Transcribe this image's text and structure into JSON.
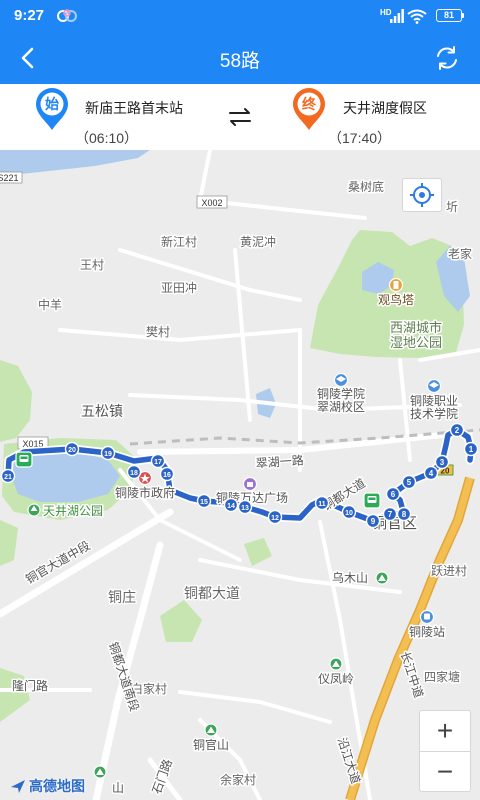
{
  "status_bar": {
    "time": "9:27",
    "network": "HD",
    "battery": "81"
  },
  "header": {
    "title": "58路"
  },
  "route": {
    "start": {
      "badge": "始",
      "name": "新庙王路首末站",
      "time": "（06:10）"
    },
    "end": {
      "badge": "终",
      "name": "天井湖度假区",
      "time": "（17:40）"
    }
  },
  "map": {
    "shields": {
      "s221": "S221",
      "x002": "X002",
      "x015": "X015",
      "g20": "20"
    },
    "places": {
      "sangshudi": "桑树底",
      "xinqi": "圻",
      "laojia": "老家",
      "xinjiangcun": "新江村",
      "huangnichong": "黄泥冲",
      "wangcun": "王村",
      "yatianchong": "亚田冲",
      "zhongyang": "中羊",
      "fancun": "樊村",
      "wusongzhen": "五松镇",
      "tongguanqu": "铜官区",
      "yuejincun": "跃进村",
      "tongzhuang": "铜庄",
      "baijiacun": "白家村",
      "sijiatang": "四家塘",
      "yujiacun": "余家村"
    },
    "pois": {
      "guanniaota": "观鸟塔",
      "xihu_park_1": "西湖城市",
      "xihu_park_2": "湿地公园",
      "tlu_1": "铜陵学院",
      "tlu_2": "翠湖校区",
      "tlvc_1": "铜陵职业",
      "tlvc_2": "技术学院",
      "city_gov": "铜陵市政府",
      "wanda": "铜陵万达广场",
      "tianjinghu_park": "天井湖公园",
      "wumushan": "乌木山",
      "tongling_station": "铜陵站",
      "yifengling": "仪凤岭",
      "tongguanshan": "铜官山",
      "hanshan_partial": "山"
    },
    "roads": {
      "cuihu_yilu": "翠湖一路",
      "tongdu_dadao_route": "铜都大道",
      "tongdu_dadao": "铜都大道",
      "tongguan_dadao_zhong": "铜官大道中段",
      "tongdu_dadao_nan": "铜都大道南段",
      "changjiang_zhongdao": "长江中道",
      "yanjiang_dadao": "沿江大道",
      "longmen_lu": "隆门路",
      "shimen_lu": "石门路"
    },
    "stops": [
      "1",
      "2",
      "3",
      "4",
      "5",
      "6",
      "7",
      "8",
      "9",
      "10",
      "11",
      "12",
      "13",
      "14",
      "15",
      "16",
      "17",
      "18",
      "19",
      "20",
      "21"
    ],
    "logo": "高德地图",
    "zoom": {
      "in": "+",
      "out": "−"
    }
  },
  "colors": {
    "brand_blue": "#1e87f5",
    "route_blue": "#2b63c6",
    "start_pin": "#1e87f5",
    "end_pin": "#f26a21",
    "park_green": "#c6e5b0",
    "water": "#aecbee",
    "highway": "#f3be52",
    "bus_station": "#2aab58"
  },
  "icons": {
    "back": "back-arrow-icon",
    "refresh": "refresh-icon",
    "swap": "swap-direction-icon",
    "locate": "locate-icon",
    "bus": "bus-station-icon",
    "start_pin": "start-pin-icon",
    "end_pin": "end-pin-icon",
    "wifi": "wifi-icon",
    "signal": "signal-icon",
    "battery": "battery-icon"
  }
}
